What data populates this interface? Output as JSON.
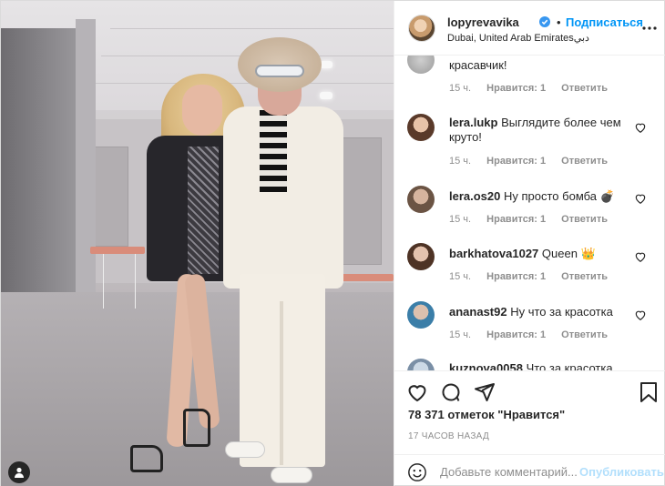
{
  "header": {
    "username": "lopyrevavika",
    "follow_label": "Подписаться",
    "separator": "•",
    "location": "Dubai, United Arab Emiratesدبي"
  },
  "comments": [
    {
      "username": "",
      "text": "красавчик!",
      "age": "15 ч.",
      "likes": "Нравится: 1",
      "reply": "Ответить"
    },
    {
      "username": "lera.lukp",
      "text": "Выглядите более чем круто!",
      "age": "15 ч.",
      "likes": "Нравится: 1",
      "reply": "Ответить"
    },
    {
      "username": "lera.os20",
      "text": "Ну просто бомба 💣",
      "age": "15 ч.",
      "likes": "Нравится: 1",
      "reply": "Ответить"
    },
    {
      "username": "barkhatova1027",
      "text": "Queen 👑",
      "age": "15 ч.",
      "likes": "Нравится: 1",
      "reply": "Ответить"
    },
    {
      "username": "ananast92",
      "text": "Ну что за красотка",
      "age": "15 ч.",
      "likes": "Нравится: 1",
      "reply": "Ответить"
    },
    {
      "username": "kuznova0058",
      "text": "Что за красотка",
      "age": "",
      "likes": "",
      "reply": ""
    }
  ],
  "post": {
    "likes_text": "78 371 отметок \"Нравится\"",
    "time_ago": "17 ЧАСОВ НАЗАД"
  },
  "add_comment": {
    "placeholder": "Добавьте комментарий...",
    "publish_label": "Опубликовать"
  },
  "icons": {
    "heart": "heart-icon",
    "comment": "comment-icon",
    "share": "paper-plane-icon",
    "save": "bookmark-icon",
    "emoji": "smiley-icon",
    "more": "more-horizontal-icon",
    "verified": "verified-badge-icon",
    "tagged": "user-tag-icon"
  },
  "colors": {
    "link_blue": "#0095f6",
    "publish_disabled": "#b2dffc",
    "meta_gray": "#8e8e8e",
    "text": "#262626"
  }
}
